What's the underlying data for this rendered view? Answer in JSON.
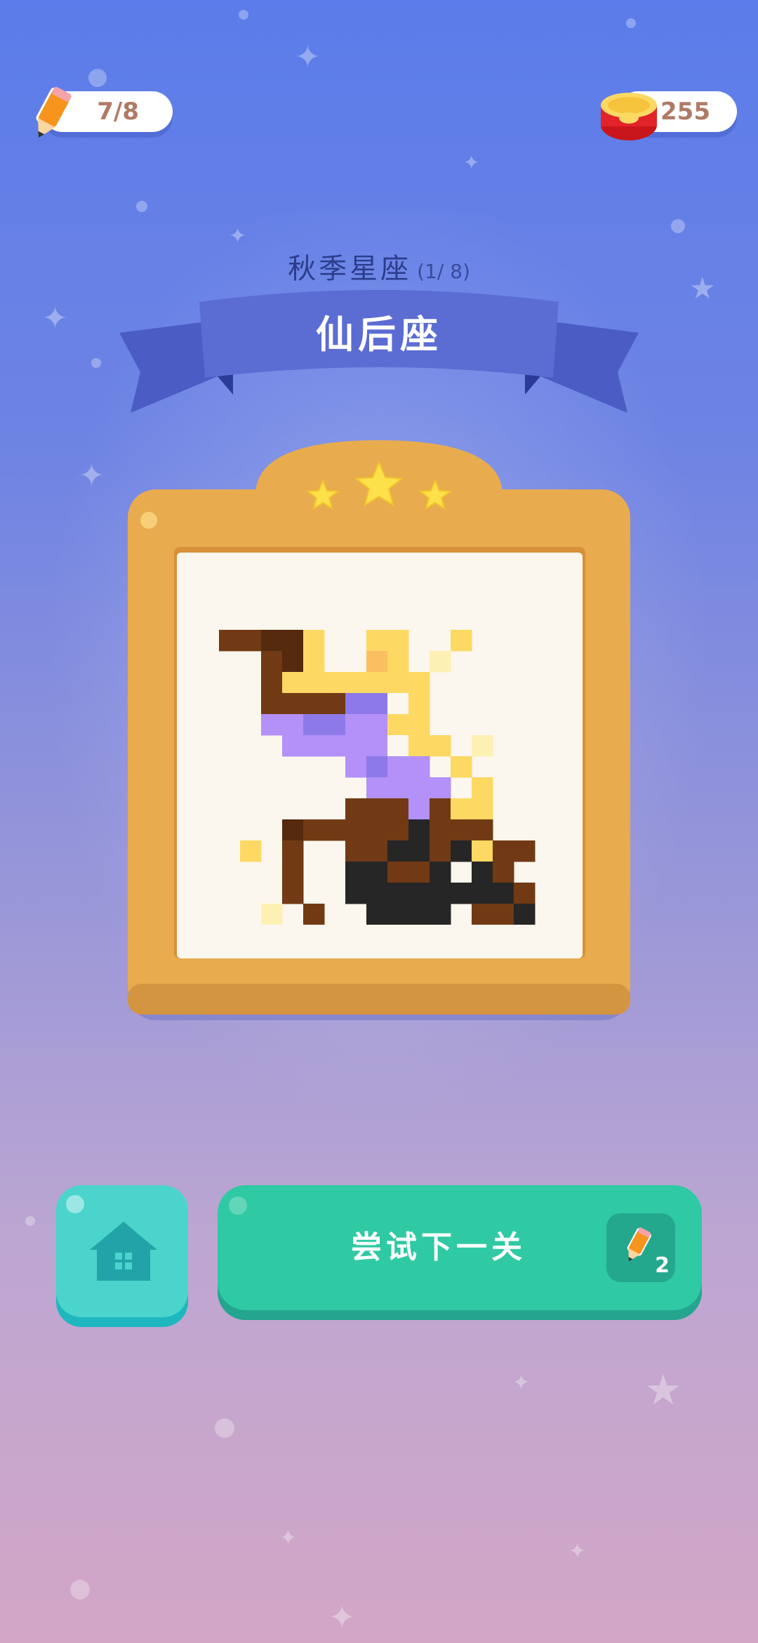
{
  "hud": {
    "pencil_count": "7/8",
    "coin_count": "255"
  },
  "header": {
    "season_label": "秋季星座",
    "progress": "(1/ 8)",
    "constellation_name": "仙后座"
  },
  "rating": {
    "stars": 3
  },
  "buttons": {
    "next_label": "尝试下一关",
    "next_cost": "2"
  },
  "colors": {
    "frame": "#e8ac4f",
    "next_button": "#2fc9a3",
    "home_button": "#4bd4cc"
  },
  "pixel_art": {
    "palette": {
      "B": "#713a14",
      "D": "#552a0e",
      "Y": "#fdd964",
      "O": "#fbbf60",
      "L": "#fdf0b3",
      "P": "#8d7ae8",
      "V": "#b391f8",
      "K": "#262626",
      "C": "#fbf7ee"
    },
    "rows": [
      "...............",
      "...............",
      "BBDDY..YY..Y...",
      "..BDY..OY.L....",
      "..BYYYYYYY.....",
      "..BBBBPPCY.....",
      "..VVPPVVYY.....",
      "...VVVVVCYY.L..",
      "......VPVV.Y...",
      ".......VVVV.Y..",
      "......BBBVBYY..",
      "...DBBBBBKBBB..",
      ".Y.B..BBKKBKYBB",
      "...B..KKBBK.KB.",
      "...B..KKKKKKKKB",
      "..L.B..KKKK.BBK"
    ]
  }
}
